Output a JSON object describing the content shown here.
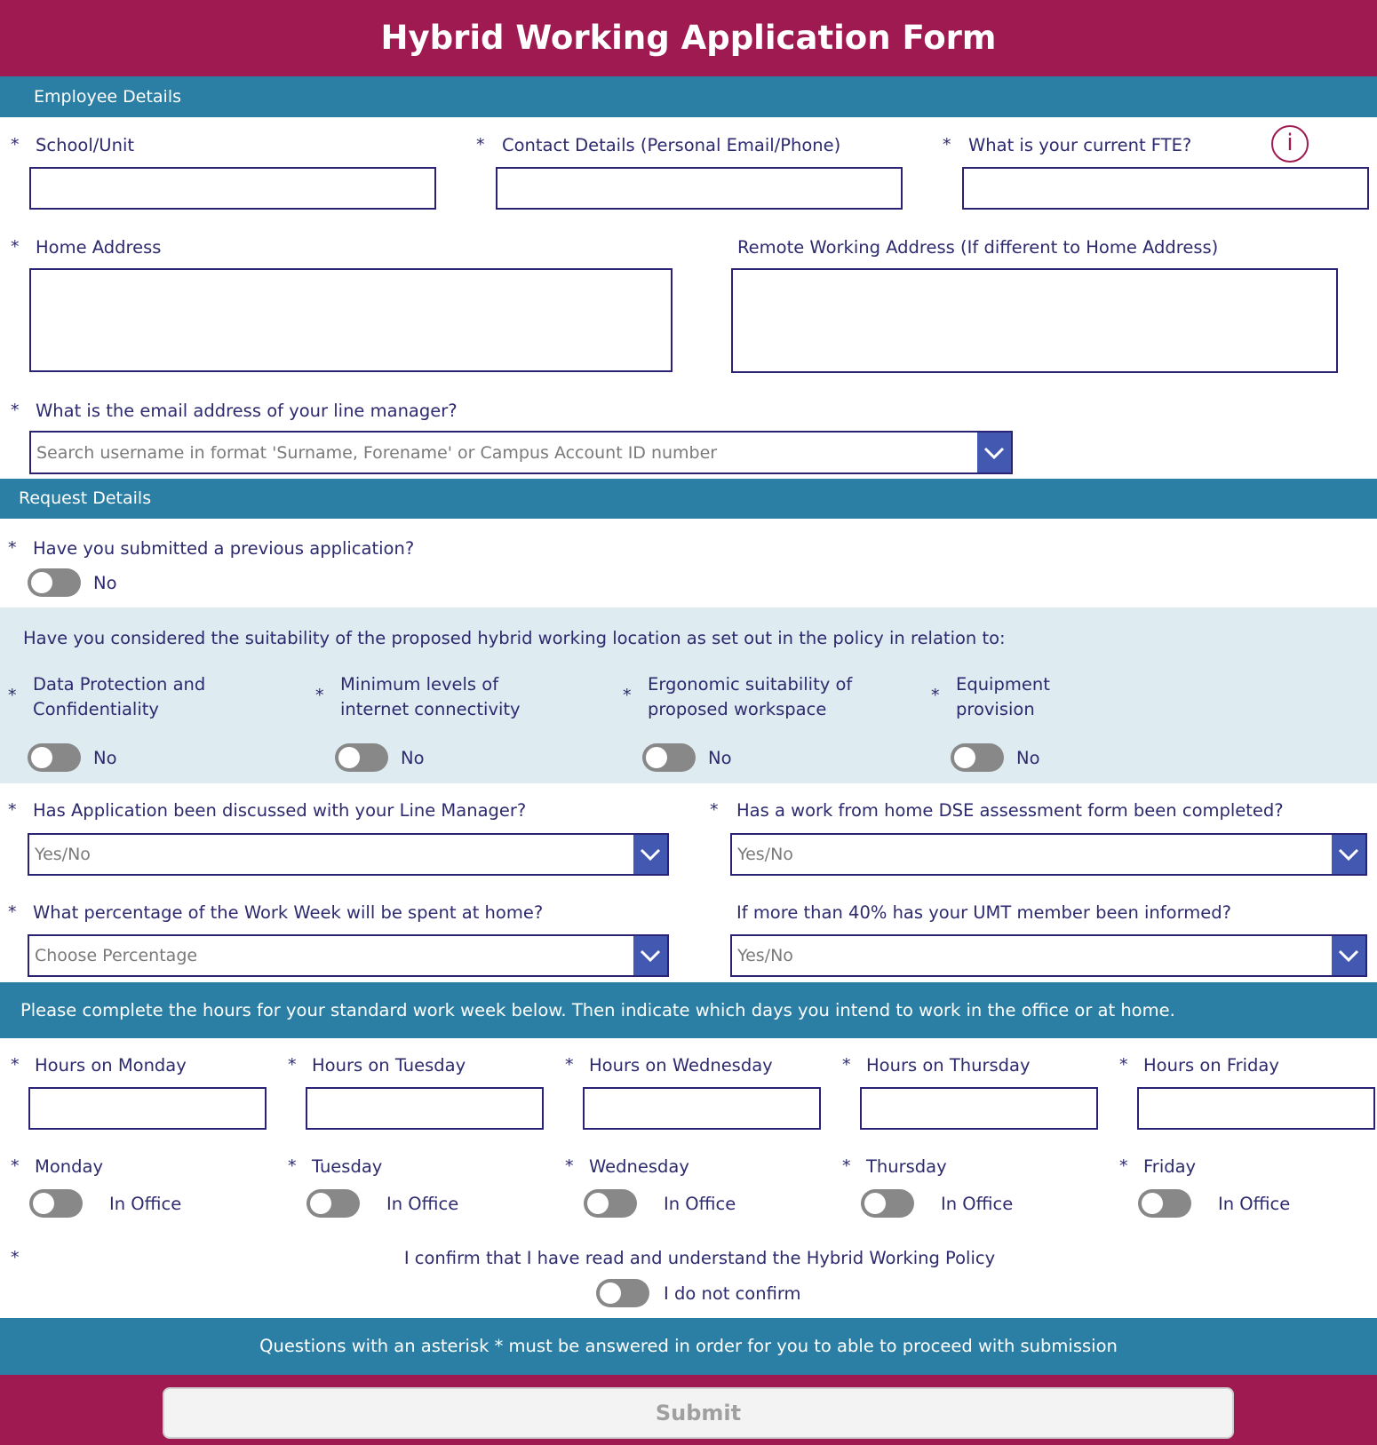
{
  "header": {
    "title": "Hybrid Working Application Form"
  },
  "sections": {
    "employee_details": "Employee Details",
    "request_details": "Request Details",
    "hours_instruction": "Please complete the hours for your standard work week below. Then indicate which days you intend to work in the office or at home.",
    "asterisk_note": "Questions with an asterisk * must be answered in order for you to able to proceed with submission"
  },
  "required_marker": "*",
  "employee": {
    "school_unit": {
      "label": "School/Unit",
      "value": ""
    },
    "contact_details": {
      "label": "Contact Details (Personal Email/Phone)",
      "value": ""
    },
    "fte": {
      "label": "What is your current FTE?",
      "value": "",
      "info_icon": "i"
    },
    "home_address": {
      "label": "Home Address",
      "value": ""
    },
    "remote_address": {
      "label": "Remote Working Address (If different to Home Address)",
      "value": ""
    },
    "line_manager": {
      "label": "What is the email address of your line manager?",
      "placeholder": "Search username in format 'Surname, Forename' or Campus Account ID number"
    }
  },
  "request": {
    "previous_application": {
      "label": "Have you submitted a previous application?",
      "toggle_text": "No",
      "on": false
    },
    "suitability_intro": "Have you considered the suitability of the proposed hybrid working location as set out in the policy in relation to:",
    "suitability_items": [
      {
        "line1": "Data Protection and",
        "line2": "Confidentiality",
        "toggle_text": "No",
        "on": false
      },
      {
        "line1": "Minimum levels of",
        "line2": "internet connectivity",
        "toggle_text": "No",
        "on": false
      },
      {
        "line1": "Ergonomic suitability of",
        "line2": "proposed workspace",
        "toggle_text": "No",
        "on": false
      },
      {
        "line1": "Equipment",
        "line2": "provision",
        "toggle_text": "No",
        "on": false
      }
    ],
    "discussed_line_manager": {
      "label": "Has Application been discussed with your Line Manager?",
      "placeholder": "Yes/No"
    },
    "dse_assessment": {
      "label": "Has a work from home DSE assessment form been completed?",
      "placeholder": "Yes/No"
    },
    "percentage_home": {
      "label": "What percentage of the Work Week will be spent at home?",
      "placeholder": "Choose Percentage"
    },
    "umt_informed": {
      "label": "If more than 40% has your UMT member been informed?",
      "placeholder": "Yes/No"
    }
  },
  "week": {
    "hours": [
      {
        "label": "Hours on Monday",
        "value": ""
      },
      {
        "label": "Hours on Tuesday",
        "value": ""
      },
      {
        "label": "Hours on Wednesday",
        "value": ""
      },
      {
        "label": "Hours on Thursday",
        "value": ""
      },
      {
        "label": "Hours on Friday",
        "value": ""
      }
    ],
    "days": [
      {
        "label": "Monday",
        "toggle_text": "In Office",
        "on": false
      },
      {
        "label": "Tuesday",
        "toggle_text": "In Office",
        "on": false
      },
      {
        "label": "Wednesday",
        "toggle_text": "In Office",
        "on": false
      },
      {
        "label": "Thursday",
        "toggle_text": "In Office",
        "on": false
      },
      {
        "label": "Friday",
        "toggle_text": "In Office",
        "on": false
      }
    ]
  },
  "confirmation": {
    "label": "I confirm that I have read and understand the Hybrid Working Policy",
    "toggle_text": "I do not confirm",
    "on": false
  },
  "submit": {
    "label": "Submit",
    "enabled": false
  },
  "colors": {
    "header": "#9e1a50",
    "section": "#2b7fa4",
    "panel": "#deebf1",
    "text": "#2d2a6e",
    "dropdown_button": "#4358b0",
    "toggle_off": "#888888"
  }
}
